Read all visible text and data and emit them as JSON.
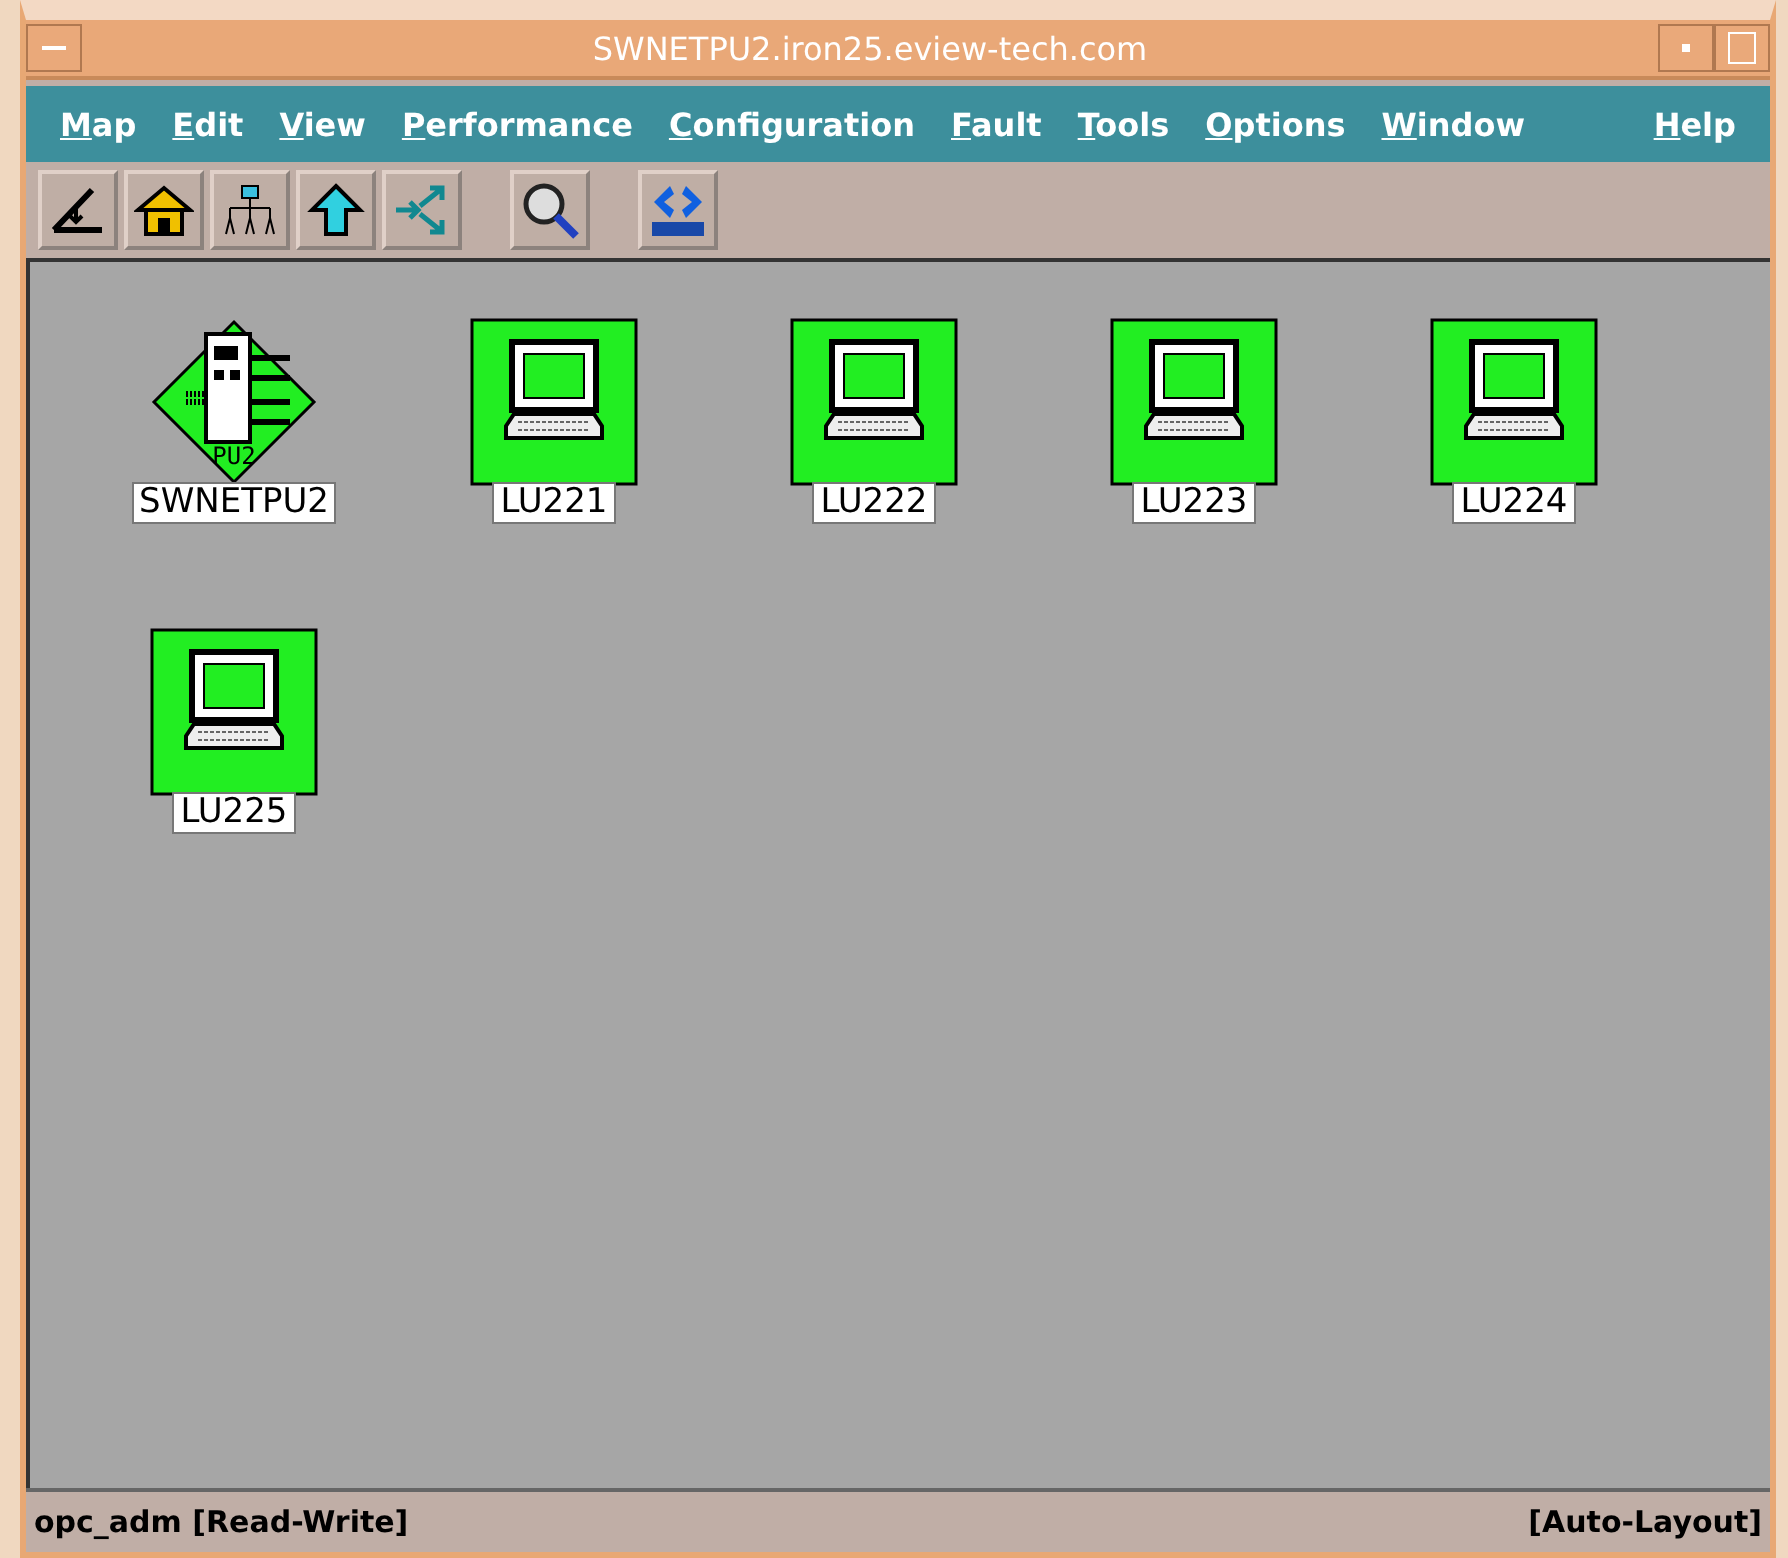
{
  "window": {
    "title": "SWNETPU2.iron25.eview-tech.com"
  },
  "menu": [
    {
      "label": "Map"
    },
    {
      "label": "Edit"
    },
    {
      "label": "View"
    },
    {
      "label": "Performance"
    },
    {
      "label": "Configuration"
    },
    {
      "label": "Fault"
    },
    {
      "label": "Tools"
    },
    {
      "label": "Options"
    },
    {
      "label": "Window"
    },
    {
      "label": "Help"
    }
  ],
  "toolbar": [
    {
      "kind": "close-map"
    },
    {
      "kind": "home"
    },
    {
      "kind": "tree"
    },
    {
      "kind": "up"
    },
    {
      "kind": "split"
    },
    {
      "kind": "gap"
    },
    {
      "kind": "search"
    },
    {
      "kind": "gap"
    },
    {
      "kind": "logo"
    }
  ],
  "map": {
    "nodes": [
      {
        "label": "SWNETPU2",
        "kind": "pu",
        "badge": "PU2"
      },
      {
        "label": "LU221",
        "kind": "lu"
      },
      {
        "label": "LU222",
        "kind": "lu"
      },
      {
        "label": "LU223",
        "kind": "lu"
      },
      {
        "label": "LU224",
        "kind": "lu"
      },
      {
        "label": "LU225",
        "kind": "lu"
      }
    ]
  },
  "status_bar": {
    "left": "opc_adm [Read-Write]",
    "right": "[Auto-Layout]"
  }
}
